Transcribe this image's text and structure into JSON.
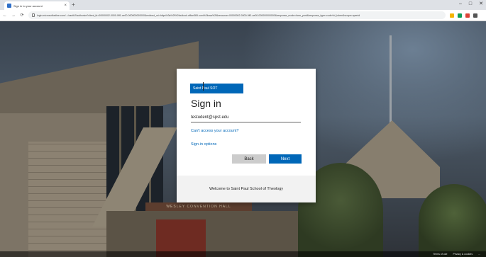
{
  "browser": {
    "tab_title": "Sign in to your account",
    "tab_close": "×",
    "new_tab": "+",
    "window_controls": [
      "–",
      "□",
      "✕"
    ],
    "url": "login.microsoftonline.com/.../oauth2/authorize?client_id=00000002-0000-0ff1-ce00-000000000000&redirect_uri=https%3a%2f%2foutlook.office365.com%2fowa%2f&resource=00000002-0000-0ff1-ce00-000000000000&response_mode=form_post&response_type=code+id_token&scope=openid",
    "nav": {
      "back": "←",
      "forward": "→",
      "reload": "⟳"
    },
    "extension_colors": [
      "#f4b400",
      "#0f9d58",
      "#db4437",
      "#555555"
    ]
  },
  "background": {
    "building_sign": "WESLEY CONVENTION HALL"
  },
  "dialog": {
    "logo_text": "Saint Paul SOT",
    "title": "Sign in",
    "account": "testudent@spst.edu",
    "cant_access": "Can't access your account?",
    "sign_in_options": "Sign-in options",
    "back_label": "Back",
    "next_label": "Next",
    "welcome": "Welcome to Saint Paul School of Theology"
  },
  "footer": {
    "terms": "Terms of use",
    "privacy": "Privacy & cookies",
    "more": "..."
  }
}
